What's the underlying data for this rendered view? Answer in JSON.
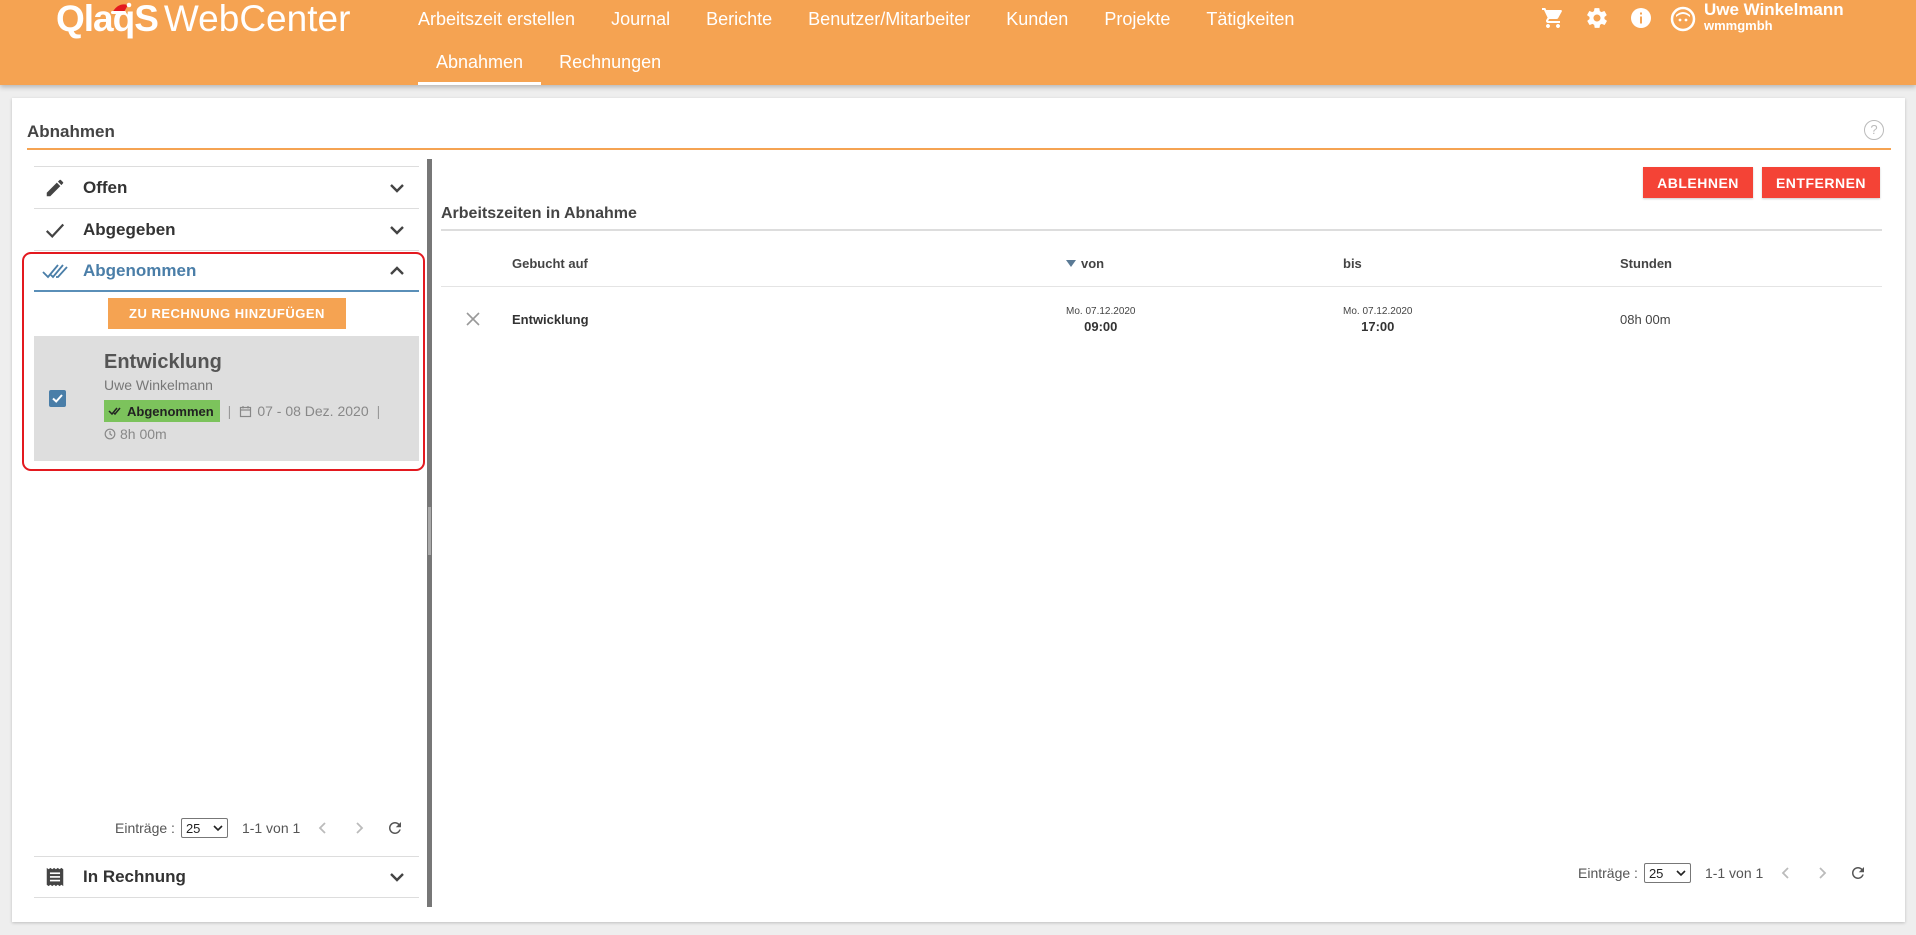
{
  "app": {
    "logo_bold": "QlaqS",
    "logo_thin": "WebCenter"
  },
  "nav": {
    "row1": [
      "Arbeitszeit erstellen",
      "Journal",
      "Berichte",
      "Benutzer/Mitarbeiter",
      "Kunden",
      "Projekte",
      "Tätigkeiten"
    ],
    "row2": [
      "Abnahmen",
      "Rechnungen"
    ],
    "active": "Abnahmen"
  },
  "header_icons": [
    "cart-icon",
    "gear-icon",
    "info-icon"
  ],
  "user": {
    "name": "Uwe Winkelmann",
    "org": "wmmgmbh"
  },
  "page": {
    "title": "Abnahmen",
    "help": "?"
  },
  "left": {
    "sections": [
      {
        "label": "Offen",
        "icon": "pencil-icon"
      },
      {
        "label": "Abgegeben",
        "icon": "check-icon"
      },
      {
        "label": "Abgenommen",
        "icon": "double-check-icon",
        "open": true
      },
      {
        "label": "In Rechnung",
        "icon": "receipt-icon"
      }
    ],
    "add_button": "ZU RECHNUNG HINZUFÜGEN",
    "entry": {
      "checked": true,
      "title": "Entwicklung",
      "user": "Uwe Winkelmann",
      "status": "Abgenommen",
      "dates": "07 - 08 Dez. 2020",
      "hours": "8h 00m"
    },
    "pager": {
      "label": "Einträge :",
      "page_size": "25",
      "range": "1-1 von 1"
    }
  },
  "right": {
    "reject_button": "ABLEHNEN",
    "remove_button": "ENTFERNEN",
    "section_title": "Arbeitszeiten in Abnahme",
    "columns": {
      "booked_on": "Gebucht auf",
      "from": "von",
      "to": "bis",
      "hours": "Stunden"
    },
    "rows": [
      {
        "booked_on": "Entwicklung",
        "from_date": "Mo. 07.12.2020",
        "from_time": "09:00",
        "to_date": "Mo. 07.12.2020",
        "to_time": "17:00",
        "hours": "08h 00m"
      }
    ],
    "pager": {
      "label": "Einträge :",
      "page_size": "25",
      "range": "1-1 von 1"
    }
  },
  "colors": {
    "header": "#f5a352",
    "accent_blue": "#4a7ea8",
    "status_green": "#7cc35c",
    "danger": "#f44336",
    "highlight_outline": "#e3191f"
  }
}
